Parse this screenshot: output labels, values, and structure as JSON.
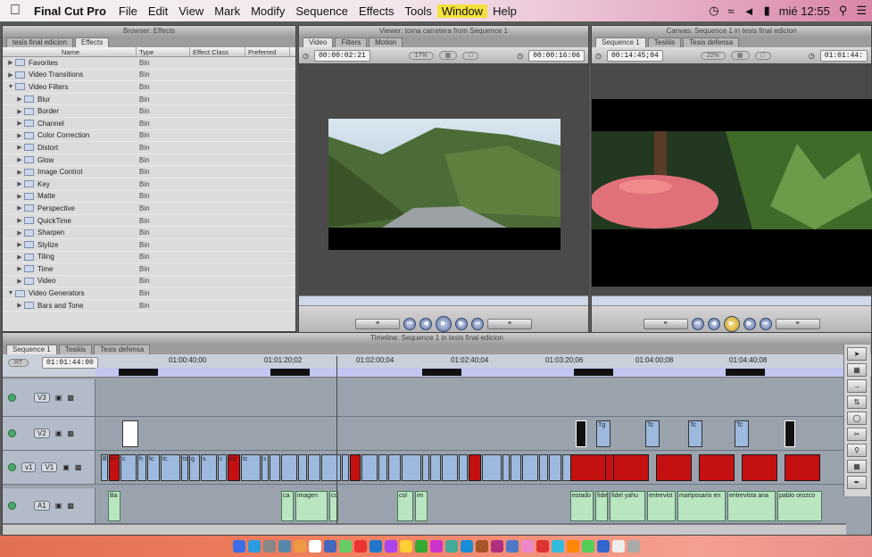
{
  "menubar": {
    "app_name": "Final Cut Pro",
    "items": [
      "File",
      "Edit",
      "View",
      "Mark",
      "Modify",
      "Sequence",
      "Effects",
      "Tools",
      "Window",
      "Help"
    ],
    "highlighted": "Window",
    "clock": "mié 12:55"
  },
  "browser": {
    "title": "Browser: Effects",
    "tabs": [
      "tesis final edicion",
      "Effects"
    ],
    "active_tab": "Effects",
    "columns": [
      "Name",
      "Type",
      "Effect Class",
      "Preferred"
    ],
    "rows": [
      {
        "name": "Favorites",
        "type": "Bin",
        "level": 0,
        "expanded": false
      },
      {
        "name": "Video Transitions",
        "type": "Bin",
        "level": 0,
        "expanded": false
      },
      {
        "name": "Video Filters",
        "type": "Bin",
        "level": 0,
        "expanded": true
      },
      {
        "name": "Blur",
        "type": "Bin",
        "level": 1,
        "expanded": false
      },
      {
        "name": "Border",
        "type": "Bin",
        "level": 1,
        "expanded": false
      },
      {
        "name": "Channel",
        "type": "Bin",
        "level": 1,
        "expanded": false
      },
      {
        "name": "Color Correction",
        "type": "Bin",
        "level": 1,
        "expanded": false
      },
      {
        "name": "Distort",
        "type": "Bin",
        "level": 1,
        "expanded": false
      },
      {
        "name": "Glow",
        "type": "Bin",
        "level": 1,
        "expanded": false
      },
      {
        "name": "Image Control",
        "type": "Bin",
        "level": 1,
        "expanded": false
      },
      {
        "name": "Key",
        "type": "Bin",
        "level": 1,
        "expanded": false
      },
      {
        "name": "Matte",
        "type": "Bin",
        "level": 1,
        "expanded": false
      },
      {
        "name": "Perspective",
        "type": "Bin",
        "level": 1,
        "expanded": false
      },
      {
        "name": "QuickTime",
        "type": "Bin",
        "level": 1,
        "expanded": false
      },
      {
        "name": "Sharpen",
        "type": "Bin",
        "level": 1,
        "expanded": false
      },
      {
        "name": "Stylize",
        "type": "Bin",
        "level": 1,
        "expanded": false
      },
      {
        "name": "Tiling",
        "type": "Bin",
        "level": 1,
        "expanded": false
      },
      {
        "name": "Time",
        "type": "Bin",
        "level": 1,
        "expanded": false
      },
      {
        "name": "Video",
        "type": "Bin",
        "level": 1,
        "expanded": false
      },
      {
        "name": "Video Generators",
        "type": "Bin",
        "level": 0,
        "expanded": true
      },
      {
        "name": "Bars and Tone",
        "type": "Bin",
        "level": 1,
        "expanded": false
      }
    ]
  },
  "viewer": {
    "title": "Viewer: toma carretera from Sequence 1",
    "tabs": [
      "Video",
      "Filters",
      "Motion"
    ],
    "timecode_duration": "00:00:02:21",
    "zoom": "17%",
    "timecode_current": "00:00:16:06"
  },
  "canvas": {
    "title": "Canvas: Sequence 1 in tesis final edicion",
    "tabs": [
      "Sequence 1",
      "Tesiiiis",
      "Tesis defensa"
    ],
    "timecode_duration": "00:14:45;04",
    "zoom": "22%",
    "timecode_current": "01:01:44:"
  },
  "timeline": {
    "title": "Timeline: Sequence 1 in tesis final edicion",
    "tabs": [
      "Sequence 1",
      "Tesiiiis",
      "Tesis defensa"
    ],
    "rt_label": "RT",
    "current_timecode": "01:01:44:00",
    "ruler": [
      "01:00:40;00",
      "01:01:20;02",
      "01:02:00;04",
      "01:02:40;04",
      "01:03:20;06",
      "01:04:00;08",
      "01:04:40;08"
    ],
    "tracks": [
      {
        "name": "V3",
        "patch": ""
      },
      {
        "name": "V2",
        "patch": ""
      },
      {
        "name": "V1",
        "patch": "v1"
      },
      {
        "name": "A1",
        "patch": ""
      }
    ],
    "audio_labels": [
      "Ba",
      "ca",
      "imagen",
      "co",
      "col",
      "im",
      "estado",
      "fide",
      "fidel yahu",
      "entrevist",
      "mariposario en",
      "entrevista ana",
      "pablo orozco"
    ],
    "video_labels": [
      "Ba",
      "m",
      "c",
      "h",
      "tc",
      "tc",
      "ts",
      "g",
      "s",
      "c",
      "co",
      "tc",
      "s",
      "Tg",
      "Tc",
      "Tc",
      "Tc"
    ]
  },
  "colors": {
    "accent": "#f3e13c",
    "clip_video": "#9db9de",
    "clip_audio": "#b9e5c1",
    "clip_red": "#c41010"
  }
}
